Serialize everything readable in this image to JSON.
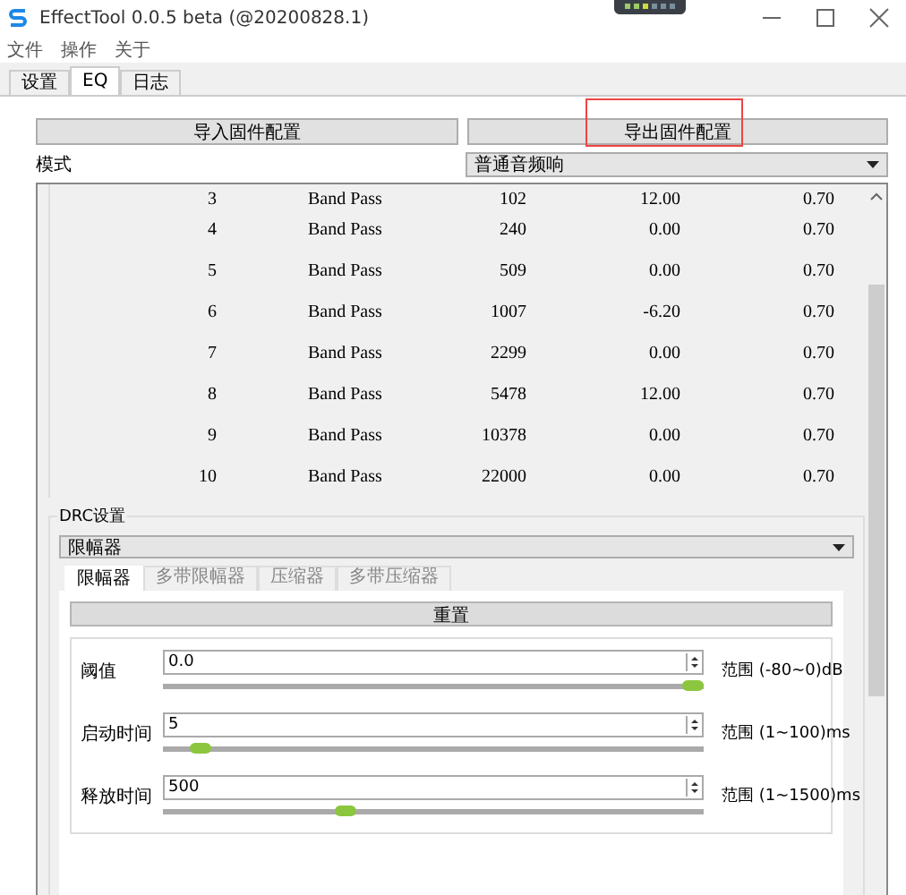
{
  "window": {
    "title": "EffectTool 0.0.5 beta  (@20200828.1)"
  },
  "menu": [
    "文件",
    "操作",
    "关于"
  ],
  "tabs": [
    {
      "label": "设置",
      "selected": false
    },
    {
      "label": "EQ",
      "selected": true
    },
    {
      "label": "日志",
      "selected": false
    }
  ],
  "buttons": [
    "导入固件配置",
    "导出固件配置"
  ],
  "mode": {
    "label": "模式",
    "value": "普通音频响"
  },
  "eq_table": {
    "rows": [
      {
        "index": "3",
        "type": "Band Pass",
        "freq": "102",
        "gain": "12.00",
        "q": "0.70"
      },
      {
        "index": "4",
        "type": "Band Pass",
        "freq": "240",
        "gain": "0.00",
        "q": "0.70"
      },
      {
        "index": "5",
        "type": "Band Pass",
        "freq": "509",
        "gain": "0.00",
        "q": "0.70"
      },
      {
        "index": "6",
        "type": "Band Pass",
        "freq": "1007",
        "gain": "-6.20",
        "q": "0.70"
      },
      {
        "index": "7",
        "type": "Band Pass",
        "freq": "2299",
        "gain": "0.00",
        "q": "0.70"
      },
      {
        "index": "8",
        "type": "Band Pass",
        "freq": "5478",
        "gain": "12.00",
        "q": "0.70"
      },
      {
        "index": "9",
        "type": "Band Pass",
        "freq": "10378",
        "gain": "0.00",
        "q": "0.70"
      },
      {
        "index": "10",
        "type": "Band Pass",
        "freq": "22000",
        "gain": "0.00",
        "q": "0.70"
      }
    ]
  },
  "drc": {
    "title": "DRC设置",
    "mode_value": "限幅器",
    "tabs": [
      {
        "label": "限幅器",
        "selected": true
      },
      {
        "label": "多带限幅器",
        "selected": false
      },
      {
        "label": "压缩器",
        "selected": false
      },
      {
        "label": "多带压缩器",
        "selected": false
      }
    ],
    "reset_button": "重置",
    "params": [
      {
        "label": "阈值",
        "value": "0.0",
        "level": 1.0,
        "range": "范围 (-80~0)dB"
      },
      {
        "label": "启动时间",
        "value": "5",
        "level": 0.05,
        "range": "范围 (1~100)ms"
      },
      {
        "label": "释放时间",
        "value": "500",
        "level": 0.33,
        "range": "范围 (1~1500)ms"
      }
    ]
  }
}
